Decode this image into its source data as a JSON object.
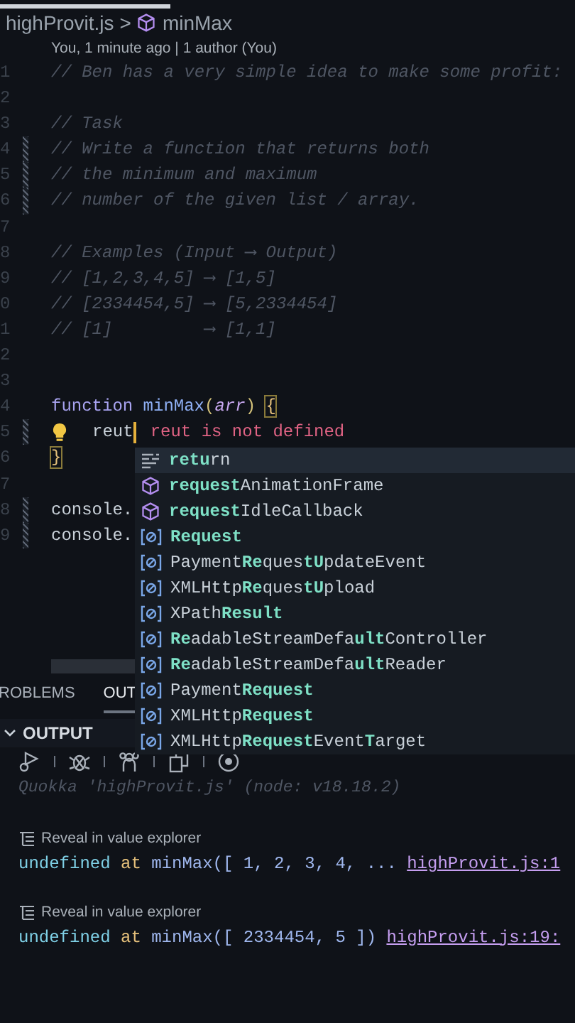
{
  "breadcrumb": {
    "file": "highProvit.js",
    "separator": ">",
    "symbol": "minMax"
  },
  "codelens": "You, 1 minute ago | 1 author (You)",
  "lines": [
    {
      "number": "1",
      "modified": false,
      "tokens": [
        {
          "kind": "comment",
          "text": "// Ben has a very simple idea to make some profit:"
        }
      ]
    },
    {
      "number": "2",
      "modified": false
    },
    {
      "number": "3",
      "modified": false,
      "tokens": [
        {
          "kind": "comment",
          "text": "// Task"
        }
      ]
    },
    {
      "number": "4",
      "modified": true,
      "tokens": [
        {
          "kind": "comment",
          "text": "// Write a function that returns both"
        }
      ]
    },
    {
      "number": "5",
      "modified": true,
      "tokens": [
        {
          "kind": "comment",
          "text": "// the minimum and maximum"
        }
      ]
    },
    {
      "number": "6",
      "modified": true,
      "tokens": [
        {
          "kind": "comment",
          "text": "// number of the given list / array."
        }
      ]
    },
    {
      "number": "7",
      "modified": false
    },
    {
      "number": "8",
      "modified": false,
      "tokens": [
        {
          "kind": "comment",
          "text": "// Examples (Input ⟶ Output)"
        }
      ]
    },
    {
      "number": "9",
      "modified": false,
      "tokens": [
        {
          "kind": "comment",
          "text": "// [1,2,3,4,5] ⟶ [1,5]"
        }
      ]
    },
    {
      "number": "0",
      "modified": false,
      "tokens": [
        {
          "kind": "comment",
          "text": "// [2334454,5] ⟶ [5,2334454]"
        }
      ]
    },
    {
      "number": "1",
      "modified": false,
      "tokens": [
        {
          "kind": "comment",
          "text": "// [1]         ⟶ [1,1]"
        }
      ]
    },
    {
      "number": "2",
      "modified": false
    },
    {
      "number": "3",
      "modified": false
    },
    {
      "number": "4",
      "modified": false,
      "tokens": [
        {
          "kind": "keyword",
          "text": "function"
        },
        {
          "kind": "function",
          "text": "minMax",
          "spaced": true
        },
        {
          "kind": "paren",
          "text": "("
        },
        {
          "kind": "param",
          "text": "arr"
        },
        {
          "kind": "paren",
          "text": ")"
        },
        {
          "kind": "bracket_match",
          "text": "{",
          "spaced": true
        }
      ]
    },
    {
      "number": "5",
      "modified": true,
      "lightbulb": true,
      "cursor": true,
      "error": "reut is not defined",
      "tokens": [
        {
          "kind": "plain",
          "text": "reut"
        }
      ]
    },
    {
      "number": "6",
      "modified": false,
      "tokens": [
        {
          "kind": "bracket_match",
          "text": "}"
        }
      ]
    },
    {
      "number": "7",
      "modified": false
    },
    {
      "number": "8",
      "modified": true,
      "tokens": [
        {
          "kind": "plain",
          "text": "console."
        }
      ]
    },
    {
      "number": "9",
      "modified": true,
      "tokens": [
        {
          "kind": "plain",
          "text": "console."
        }
      ]
    }
  ],
  "suggestions": [
    {
      "kind": "keyword",
      "label": "**retu**rn",
      "selected": true
    },
    {
      "kind": "method",
      "label": "**request**AnimationFrame",
      "selected": false
    },
    {
      "kind": "method",
      "label": "**request**IdleCallback",
      "selected": false
    },
    {
      "kind": "variable",
      "label": "**Request**",
      "selected": false
    },
    {
      "kind": "variable",
      "label": "Payment**Re**ques**tU**pdateEvent",
      "selected": false
    },
    {
      "kind": "variable",
      "label": "XMLHttp**Re**ques**tU**pload",
      "selected": false
    },
    {
      "kind": "variable",
      "label": "XPath**Result**",
      "selected": false
    },
    {
      "kind": "variable",
      "label": "**Re**adableStreamDefa**ult**Controller",
      "selected": false
    },
    {
      "kind": "variable",
      "label": "**Re**adableStreamDefa**ult**Reader",
      "selected": false
    },
    {
      "kind": "variable",
      "label": "Payment**Request**",
      "selected": false
    },
    {
      "kind": "variable",
      "label": "XMLHttp**Request**",
      "selected": false
    },
    {
      "kind": "variable",
      "label": "XMLHttp**Request**Event**T**arget",
      "selected": false
    }
  ],
  "panel_tabs": [
    {
      "label": "ROBLEMS",
      "selected": false
    },
    {
      "label": "OUT",
      "selected": true
    }
  ],
  "output": {
    "title": "OUTPUT",
    "expanded": true,
    "header": "Quokka 'highProvit.js' (node: v18.18.2)",
    "entries": [
      {
        "reveal": "Reveal in value explorer",
        "tokens": [
          {
            "kind": "undef",
            "text": "undefined"
          },
          {
            "kind": "at",
            "text": "at",
            "spaced": true
          },
          {
            "kind": "call",
            "text": "minMax([ 1, 2, 3, 4, ...",
            "spaced": true
          },
          {
            "kind": "link",
            "text": "highProvit.js:1",
            "spaced": true
          }
        ]
      },
      {
        "reveal": "Reveal in value explorer",
        "tokens": [
          {
            "kind": "undef",
            "text": "undefined"
          },
          {
            "kind": "at",
            "text": "at",
            "spaced": true
          },
          {
            "kind": "call",
            "text": "minMax([ 2334454, 5 ])",
            "spaced": true
          },
          {
            "kind": "link",
            "text": "highProvit.js:19:",
            "spaced": true
          }
        ]
      }
    ]
  }
}
